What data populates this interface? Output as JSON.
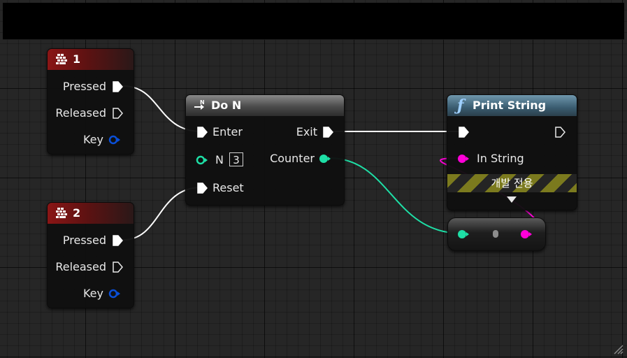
{
  "graph": {
    "nodes": {
      "key1": {
        "title": "1",
        "pins": {
          "pressed": "Pressed",
          "released": "Released",
          "key": "Key"
        }
      },
      "key2": {
        "title": "2",
        "pins": {
          "pressed": "Pressed",
          "released": "Released",
          "key": "Key"
        }
      },
      "do_n": {
        "title": "Do N",
        "pins": {
          "enter": "Enter",
          "exit": "Exit",
          "n": "N",
          "n_value": "3",
          "counter": "Counter",
          "reset": "Reset"
        }
      },
      "print_string": {
        "title": "Print String",
        "pins": {
          "in_string": "In String"
        },
        "dev_only_label": "개발 전용"
      }
    }
  },
  "icons": {
    "keyboard_event": "keyboard-icon",
    "do_n": "do-n-macro-icon",
    "function": "function-icon"
  },
  "colors": {
    "exec_wire": "#ffffff",
    "integer_pin": "#1edfa6",
    "string_pin": "#ff00d8",
    "key_struct_pin": "#0a4fd8",
    "event_header": "#8a1515",
    "function_header": "#4f7a92",
    "dev_only_stripe": "#7b7a1e"
  }
}
